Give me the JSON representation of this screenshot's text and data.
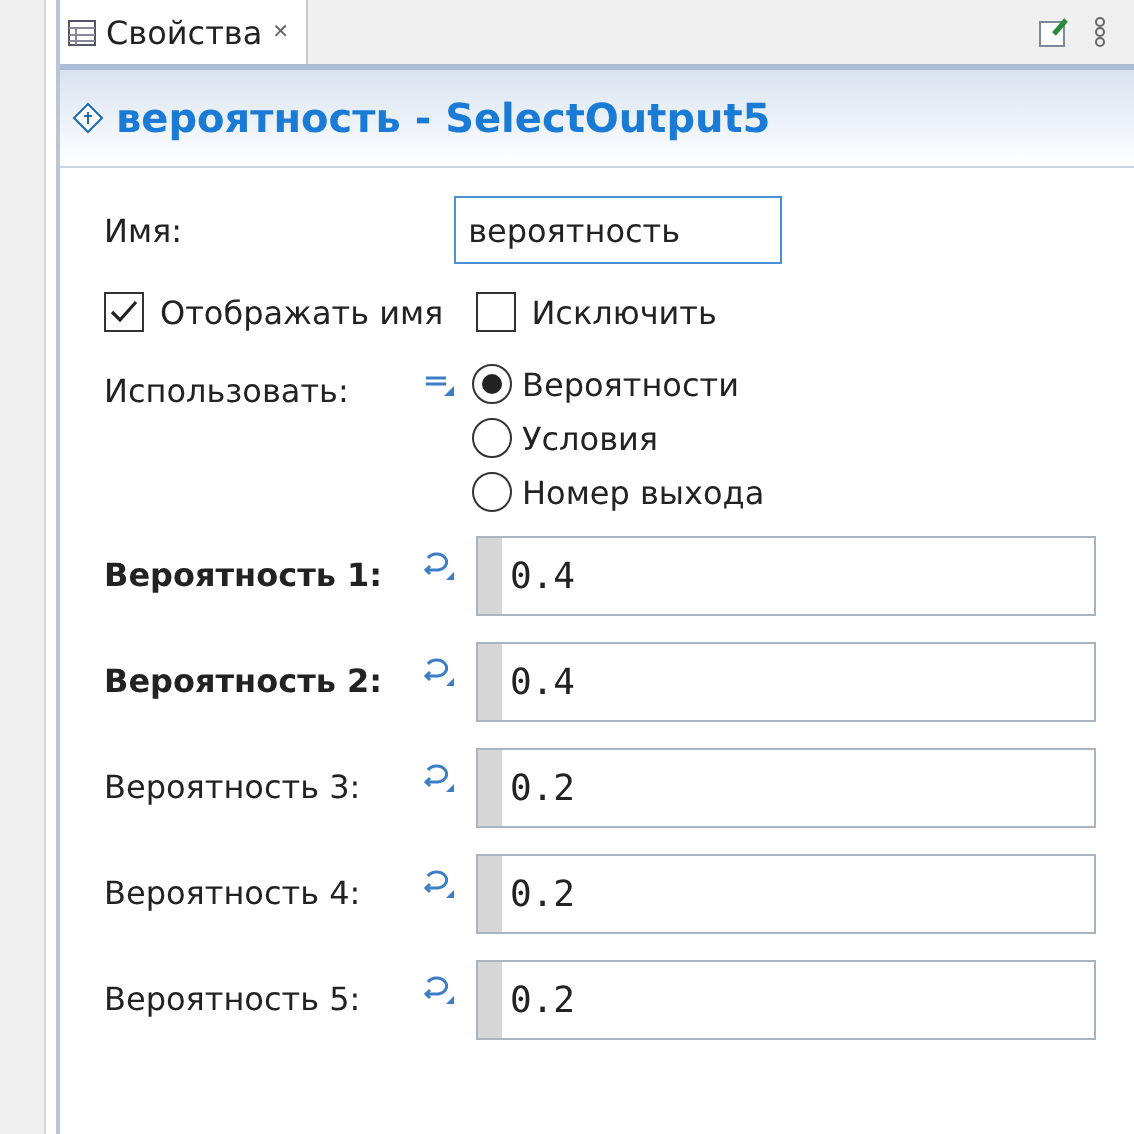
{
  "tab": {
    "label": "Свойства",
    "close": "✕"
  },
  "header": {
    "title": "вероятность - SelectOutput5"
  },
  "name_field": {
    "label": "Имя:",
    "value": "вероятность"
  },
  "checkboxes": [
    {
      "label": "Отображать имя",
      "checked": true
    },
    {
      "label": "Исключить",
      "checked": false
    }
  ],
  "use": {
    "label": "Использовать:",
    "options": [
      {
        "label": "Вероятности",
        "selected": true
      },
      {
        "label": "Условия",
        "selected": false
      },
      {
        "label": "Номер выхода",
        "selected": false
      }
    ]
  },
  "probabilities": [
    {
      "label": "Вероятность 1:",
      "value": "0.4",
      "bold": true
    },
    {
      "label": "Вероятность 2:",
      "value": "0.4",
      "bold": true
    },
    {
      "label": "Вероятность 3:",
      "value": "0.2",
      "bold": false
    },
    {
      "label": "Вероятность 4:",
      "value": "0.2",
      "bold": false
    },
    {
      "label": "Вероятность 5:",
      "value": "0.2",
      "bold": false
    }
  ]
}
